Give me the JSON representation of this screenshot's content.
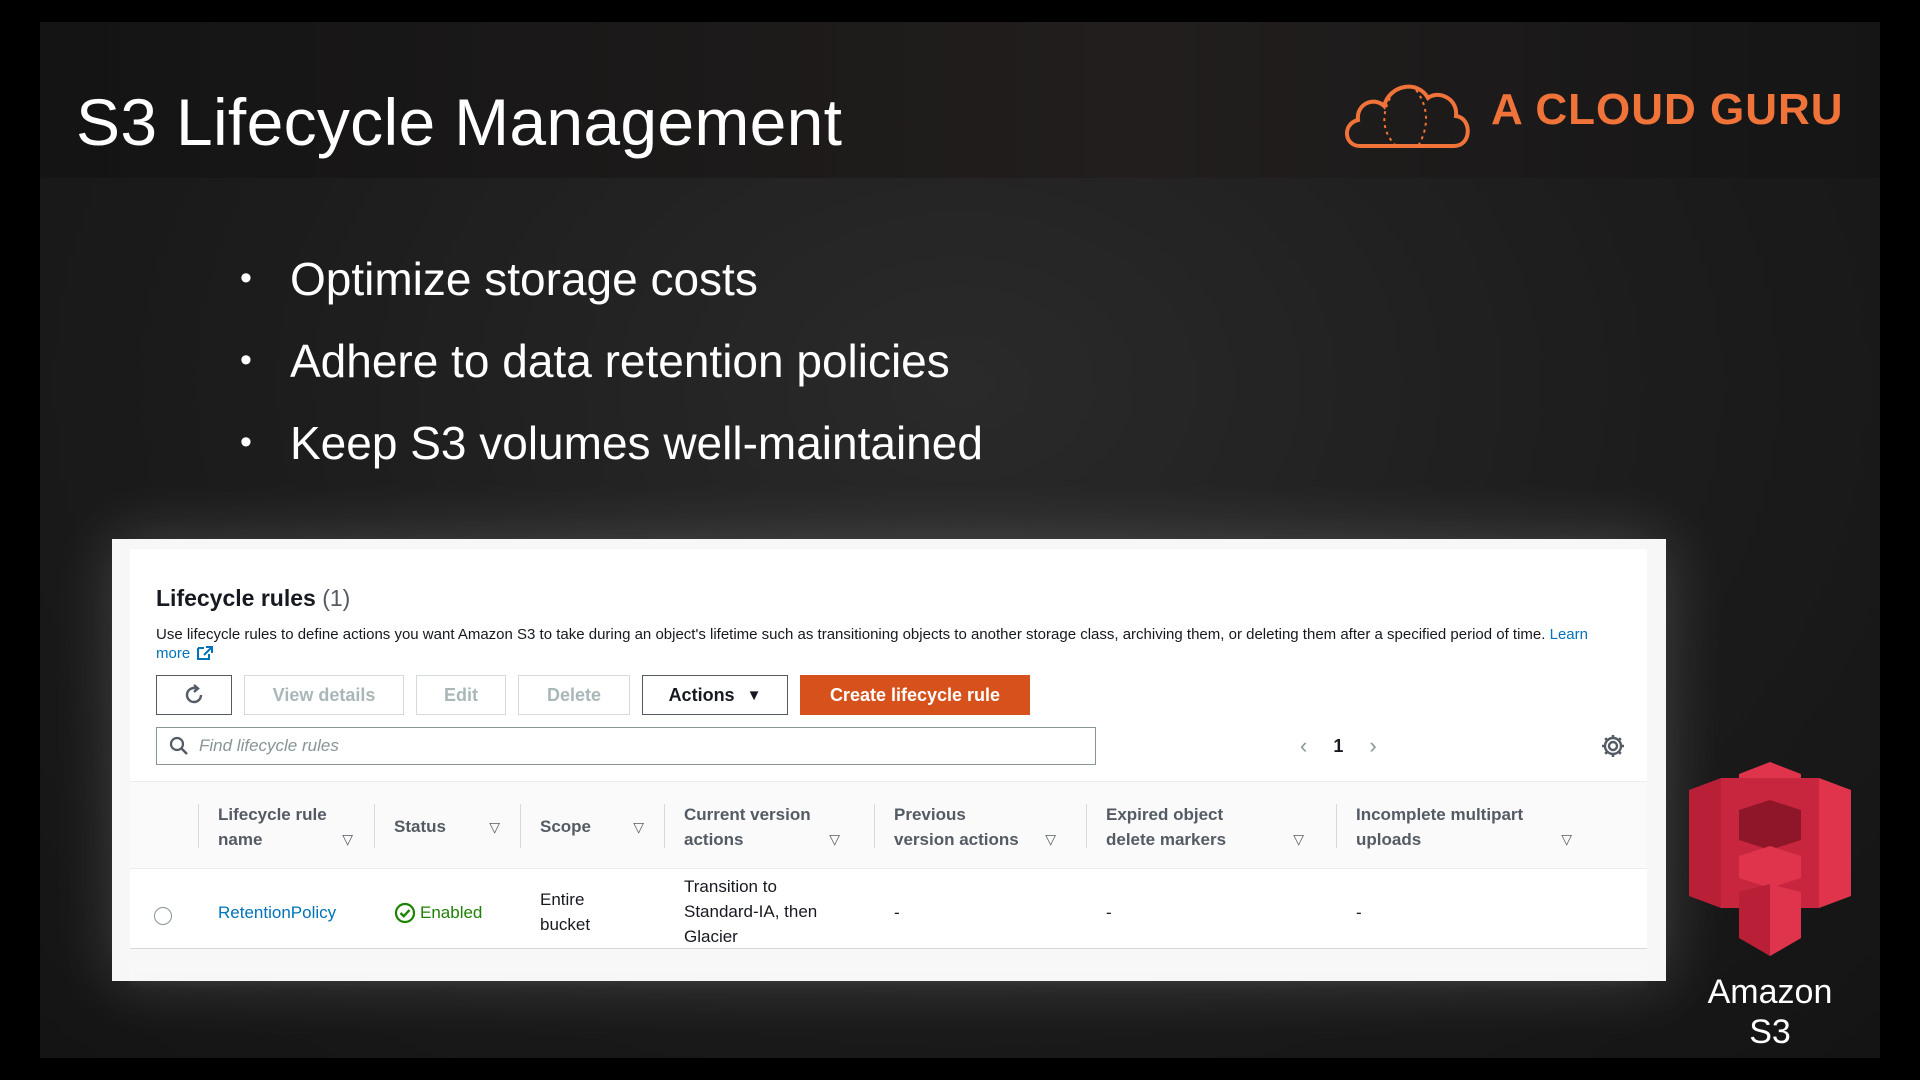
{
  "slide": {
    "title": "S3 Lifecycle Management",
    "brand": "A CLOUD GURU",
    "bullets": [
      "Optimize storage costs",
      "Adhere to data retention policies",
      "Keep S3 volumes well-maintained"
    ],
    "logo_label_line1": "Amazon",
    "logo_label_line2": "S3"
  },
  "panel": {
    "heading": "Lifecycle rules",
    "count": "(1)",
    "description": "Use lifecycle rules to define actions you want Amazon S3 to take during an object's lifetime such as transitioning objects to another storage class, archiving them, or deleting them after a specified period of time.",
    "learn_more": "Learn more",
    "toolbar": {
      "view_details": "View details",
      "edit": "Edit",
      "delete": "Delete",
      "actions": "Actions",
      "create": "Create lifecycle rule"
    },
    "search_placeholder": "Find lifecycle rules",
    "page_number": "1",
    "columns": {
      "name_1": "Lifecycle rule",
      "name_2": "name",
      "status": "Status",
      "scope": "Scope",
      "current_1": "Current version",
      "current_2": "actions",
      "previous_1": "Previous",
      "previous_2": "version actions",
      "expired_1": "Expired object",
      "expired_2": "delete markers",
      "incomplete_1": "Incomplete multipart",
      "incomplete_2": "uploads"
    },
    "row": {
      "name": "RetentionPolicy",
      "status": "Enabled",
      "scope_1": "Entire",
      "scope_2": "bucket",
      "current_1": "Transition to",
      "current_2": "Standard-IA, then",
      "current_3": "Glacier",
      "previous": "-",
      "expired": "-",
      "incomplete": "-"
    }
  },
  "colors": {
    "brand_orange": "#f0733a",
    "primary_button": "#d6511b",
    "link_blue": "#0073bb",
    "enabled_green": "#1d8102",
    "s3_red": "#c7263e"
  }
}
